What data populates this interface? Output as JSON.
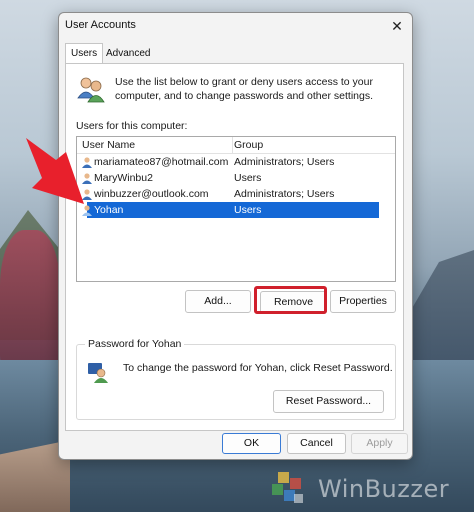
{
  "window": {
    "title": "User Accounts",
    "close_glyph": "✕"
  },
  "tabs": [
    {
      "label": "Users",
      "active": true
    },
    {
      "label": "Advanced",
      "active": false
    }
  ],
  "intro_text": "Use the list below to grant or deny users access to your computer, and to change passwords and other settings.",
  "list": {
    "caption": "Users for this computer:",
    "columns": [
      "User Name",
      "Group"
    ],
    "rows": [
      {
        "name": "mariamateo87@hotmail.com",
        "group": "Administrators; Users",
        "selected": false
      },
      {
        "name": "MaryWinbu2",
        "group": "Users",
        "selected": false
      },
      {
        "name": "winbuzzer@outlook.com",
        "group": "Administrators; Users",
        "selected": false
      },
      {
        "name": "Yohan",
        "group": "Users",
        "selected": true
      }
    ]
  },
  "buttons": {
    "add": "Add...",
    "remove": "Remove",
    "properties": "Properties",
    "reset_password": "Reset Password...",
    "ok": "OK",
    "cancel": "Cancel",
    "apply": "Apply"
  },
  "password_group": {
    "legend": "Password for Yohan",
    "text": "To change the password for Yohan, click Reset Password."
  },
  "watermark": {
    "text": "WinBuzzer"
  },
  "colors": {
    "selection": "#1468d6",
    "highlight_box": "#d0202c",
    "arrow": "#e8202c"
  }
}
